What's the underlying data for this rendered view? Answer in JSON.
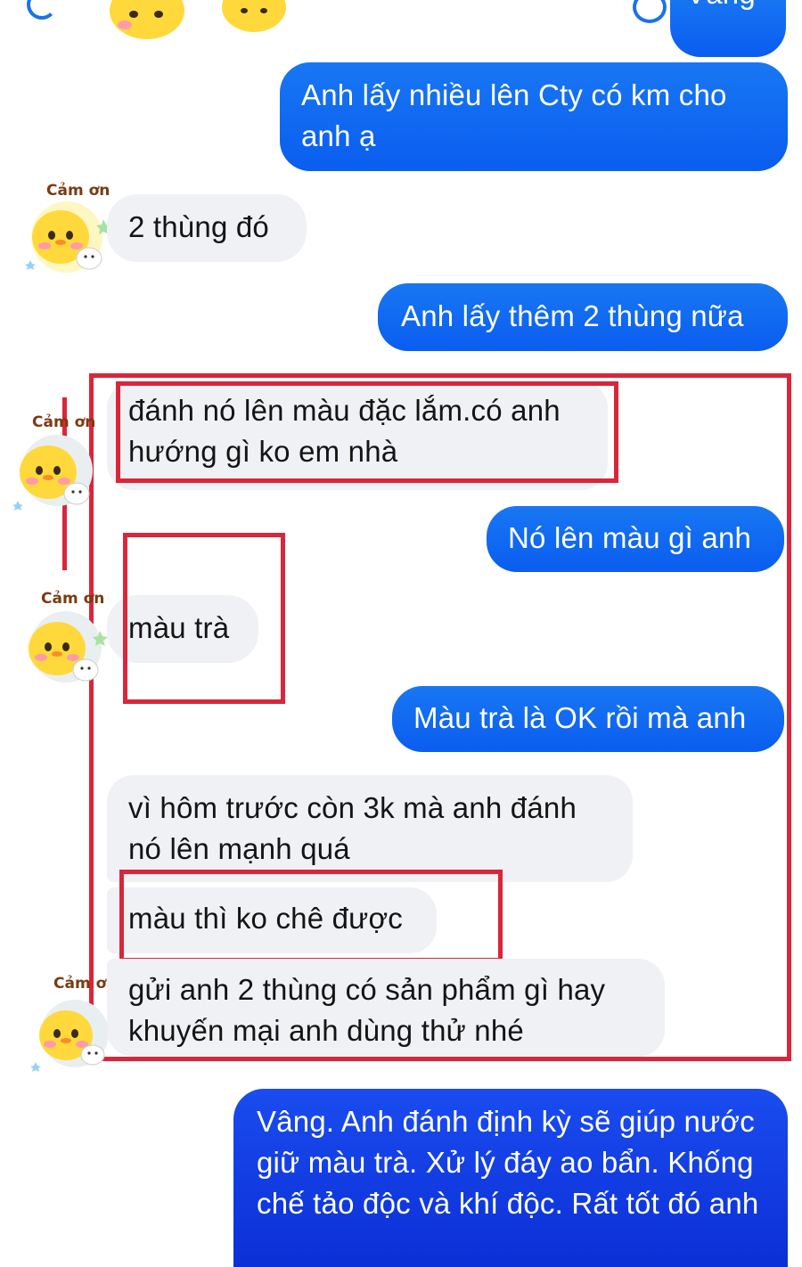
{
  "header": {
    "partial_title": "Vâng"
  },
  "avatar": {
    "caption": "Cảm ơn"
  },
  "messages": [
    {
      "side": "out",
      "text": "Anh lấy nhiều lên Cty có km cho anh ạ"
    },
    {
      "side": "in",
      "text": "2 thùng đó"
    },
    {
      "side": "out",
      "text": "Anh lấy thêm 2 thùng nữa"
    },
    {
      "side": "in",
      "text": "đánh nó lên màu đặc lắm.có anh hướng gì ko em nhà"
    },
    {
      "side": "out",
      "text": "Nó lên màu gì anh"
    },
    {
      "side": "in",
      "text": "màu trà"
    },
    {
      "side": "out",
      "text": "Màu trà là OK rồi mà anh"
    },
    {
      "side": "in",
      "text": "vì hôm trước còn 3k mà anh đánh nó lên mạnh quá"
    },
    {
      "side": "in",
      "text": "màu thì ko chê được"
    },
    {
      "side": "in",
      "text": "gửi anh 2 thùng có sản phẩm gì hay khuyến mại anh dùng thử nhé"
    },
    {
      "side": "out",
      "text": "Vâng. Anh đánh định kỳ sẽ giúp nước giữ màu trà. Xử lý đáy ao bẩn. Khống chế tảo độc và khí độc. Rất tốt đó anh"
    }
  ],
  "colors": {
    "outgoing_bubble": "#0866ff",
    "incoming_bubble": "#f0f1f5",
    "highlight": "#d9263a"
  },
  "icons": [
    "back-icon",
    "chick-sticker-icon",
    "call-icon",
    "info-icon"
  ]
}
